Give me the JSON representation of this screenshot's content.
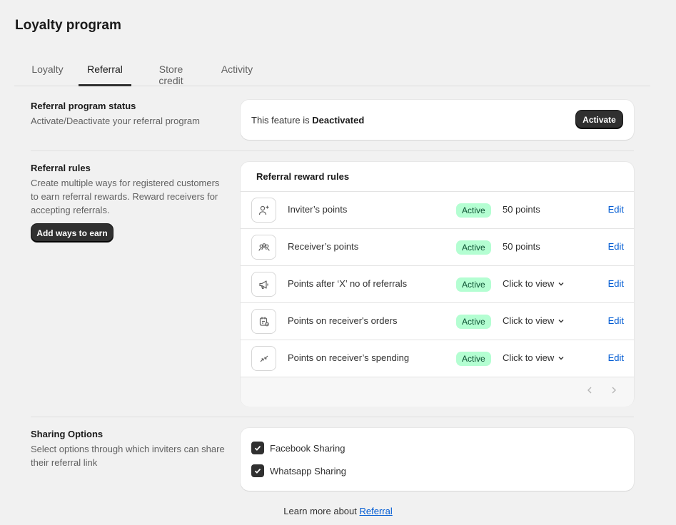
{
  "page": {
    "title": "Loyalty program"
  },
  "tabs": [
    {
      "label": "Loyalty"
    },
    {
      "label": "Referral",
      "active": true
    },
    {
      "label": "Store credit"
    },
    {
      "label": "Activity"
    }
  ],
  "status_section": {
    "heading": "Referral program status",
    "description": "Activate/Deactivate your referral program",
    "feature_prefix": "This feature is",
    "feature_state": "Deactivated",
    "activate_label": "Activate"
  },
  "rules_section": {
    "heading": "Referral rules",
    "description": "Create multiple ways for registered customers to earn referral rewards. Reward receivers for accepting referrals.",
    "add_label": "Add ways to earn",
    "card_title": "Referral reward rules",
    "rules": [
      {
        "name": "Inviter’s points",
        "status": "Active",
        "value": "50 points",
        "edit": "Edit",
        "icon": "person-add-icon"
      },
      {
        "name": "Receiver’s points",
        "status": "Active",
        "value": "50 points",
        "edit": "Edit",
        "icon": "people-icon"
      },
      {
        "name": "Points after ‘X’ no of referrals",
        "status": "Active",
        "value": "Click to view",
        "edit": "Edit",
        "icon": "megaphone-icon"
      },
      {
        "name": "Points on receiver's orders",
        "status": "Active",
        "value": "Click to view",
        "edit": "Edit",
        "icon": "order-icon"
      },
      {
        "name": "Points on receiver’s spending",
        "status": "Active",
        "value": "Click to view",
        "edit": "Edit",
        "icon": "arrows-icon"
      }
    ]
  },
  "sharing_section": {
    "heading": "Sharing Options",
    "description": "Select options through which inviters can share their referral link",
    "options": [
      {
        "label": "Facebook Sharing",
        "checked": true
      },
      {
        "label": "Whatsapp Sharing",
        "checked": true
      }
    ]
  },
  "footer": {
    "prefix": "Learn more about",
    "link_label": "Referral"
  },
  "colors": {
    "accent_link": "#005bd3",
    "active_badge": "#b4fed2",
    "dark_button": "#303030"
  }
}
